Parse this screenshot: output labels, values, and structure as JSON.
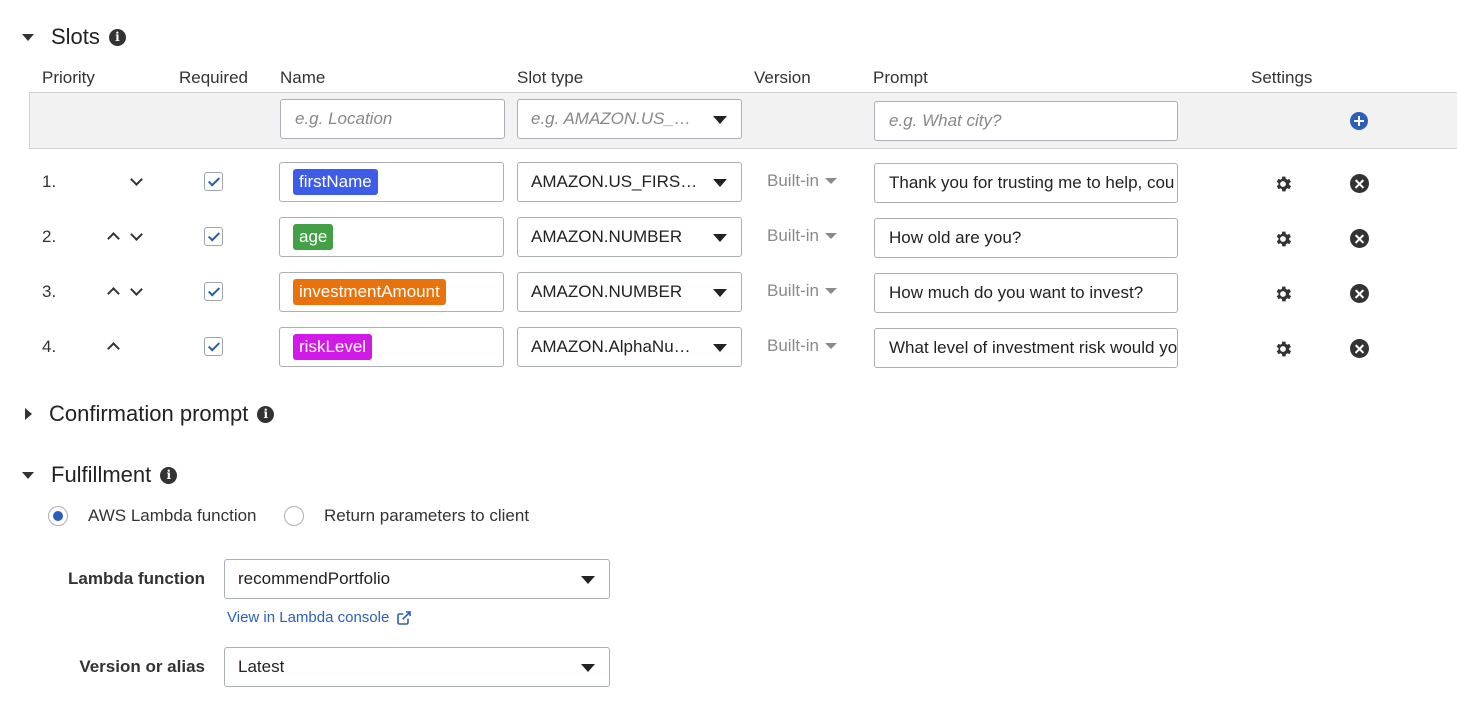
{
  "slots_section": {
    "title": "Slots"
  },
  "columns": {
    "priority": "Priority",
    "required": "Required",
    "name": "Name",
    "slot_type": "Slot type",
    "version": "Version",
    "prompt": "Prompt",
    "settings": "Settings"
  },
  "new_slot": {
    "name_placeholder": "e.g. Location",
    "type_placeholder": "e.g. AMAZON.US_CI...",
    "prompt_placeholder": "e.g. What city?"
  },
  "slots": [
    {
      "number": "1.",
      "name": "firstName",
      "color": "#3d5ce8",
      "type": "AMAZON.US_FIRST...",
      "version": "Built-in",
      "prompt": "Thank you for trusting me to help, cou",
      "required": true
    },
    {
      "number": "2.",
      "name": "age",
      "color": "#43a047",
      "type": "AMAZON.NUMBER",
      "version": "Built-in",
      "prompt": "How old are you?",
      "required": true
    },
    {
      "number": "3.",
      "name": "investmentAmount",
      "color": "#e8730c",
      "type": "AMAZON.NUMBER",
      "version": "Built-in",
      "prompt": "How much do you want to invest?",
      "required": true
    },
    {
      "number": "4.",
      "name": "riskLevel",
      "color": "#d21ae8",
      "type": "AMAZON.AlphaNum...",
      "version": "Built-in",
      "prompt": "What level of investment risk would yo",
      "required": true
    }
  ],
  "confirmation_section": {
    "title": "Confirmation prompt"
  },
  "fulfillment_section": {
    "title": "Fulfillment",
    "option_lambda": "AWS Lambda function",
    "option_client": "Return parameters to client",
    "selected": "AWS Lambda function",
    "lambda_label": "Lambda function",
    "lambda_value": "recommendPortfolio",
    "console_link": "View in Lambda console",
    "version_label": "Version or alias",
    "version_value": "Latest"
  }
}
